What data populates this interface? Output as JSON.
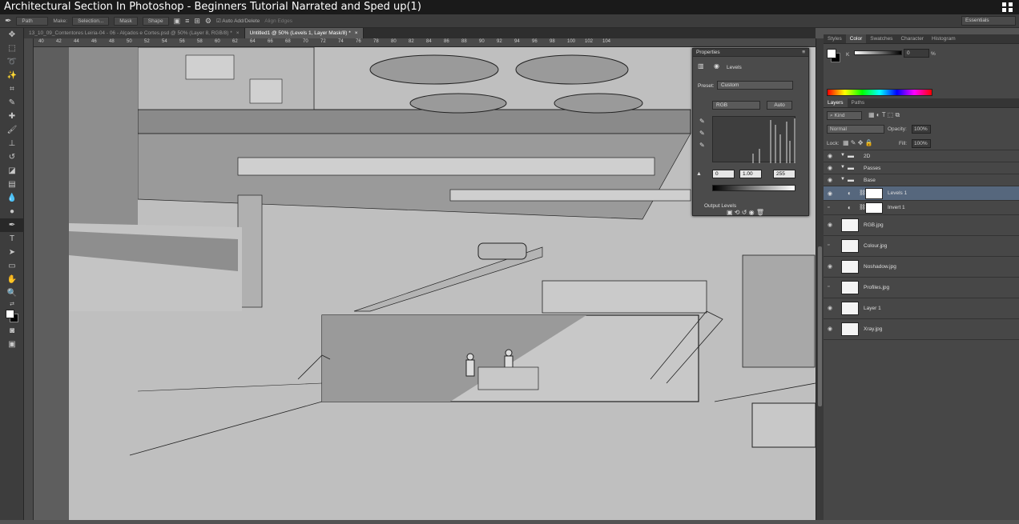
{
  "window": {
    "title": "Architectural Section In Photoshop - Beginners Tutorial Narrated and Sped up(1)"
  },
  "options": {
    "mode": "Path",
    "make_label": "Make:",
    "selection": "Selection...",
    "mask": "Mask",
    "shape": "Shape",
    "auto_add_delete": "Auto Add/Delete",
    "align_edges": "Align Edges",
    "workspace": "Essentials"
  },
  "tabs": [
    {
      "label": "13_10_09_Contentores Leiria-04 - 06 - Alçados e Cortes.psd @ 50% (Layer 8, RGB/8) *",
      "close": "×"
    },
    {
      "label": "Untitled1 @ 50% (Levels 1, Layer Mask/8) *",
      "close": "×"
    }
  ],
  "ruler": {
    "ticks": [
      "40",
      "42",
      "44",
      "46",
      "48",
      "50",
      "52",
      "54",
      "56",
      "58",
      "60",
      "62",
      "64",
      "66",
      "68",
      "70",
      "72",
      "74",
      "76",
      "78",
      "80",
      "82",
      "84",
      "86",
      "88",
      "90",
      "92",
      "94",
      "96",
      "98",
      "100",
      "102",
      "104"
    ]
  },
  "properties": {
    "panel_title": "Properties",
    "adjustment": "Levels",
    "preset_label": "Preset:",
    "preset_value": "Custom",
    "channel": "RGB",
    "auto": "Auto",
    "input_black": "0",
    "input_gamma": "1.00",
    "input_white": "255",
    "output_label": "Output Levels"
  },
  "color_panel": {
    "tabs": [
      "Styles",
      "Color",
      "Swatches",
      "Character",
      "Histogram"
    ],
    "active": "Color",
    "k_label": "K",
    "k_value": "0",
    "percent": "%"
  },
  "layers_panel": {
    "tabs": [
      "Layers",
      "Paths"
    ],
    "active": "Layers",
    "kind": "Kind",
    "blend": "Normal",
    "opacity_label": "Opacity:",
    "opacity": "100%",
    "lock_label": "Lock:",
    "fill_label": "Fill:",
    "fill": "100%",
    "groups": [
      {
        "name": "2D"
      },
      {
        "name": "Passes"
      },
      {
        "name": "Base"
      }
    ],
    "adjust_layers": [
      {
        "name": "Levels 1",
        "selected": true,
        "visible": true
      },
      {
        "name": "Invert 1",
        "selected": false,
        "visible": false
      }
    ],
    "layers": [
      {
        "name": "RGB.jpg",
        "visible": true
      },
      {
        "name": "Colour.jpg",
        "visible": false
      },
      {
        "name": "Noshadow.jpg",
        "visible": true
      },
      {
        "name": "Profiles.jpg",
        "visible": false
      },
      {
        "name": "Layer 1",
        "visible": true
      },
      {
        "name": "Xray.jpg",
        "visible": true
      }
    ]
  },
  "colors": {
    "selected_layer": "#56677d",
    "canvas": "#bfbfbf",
    "shadow": "#8a8a8a"
  }
}
